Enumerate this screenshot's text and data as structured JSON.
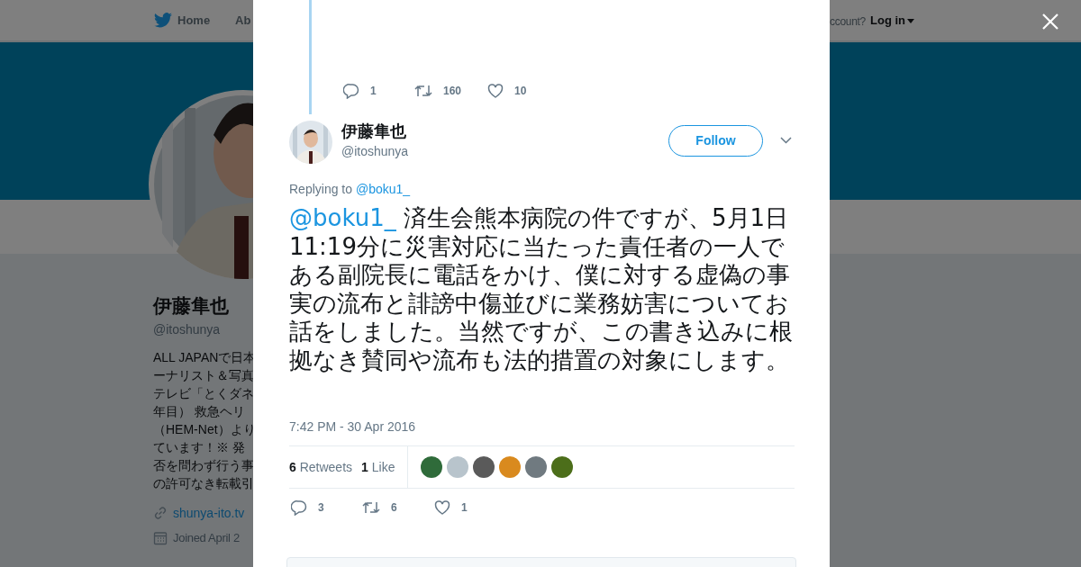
{
  "background_page": {
    "nav": {
      "home": "Home",
      "about": "Ab",
      "account_prompt": "ccount?",
      "login": "Log in"
    },
    "profile": {
      "name": "伊藤隼也",
      "handle": "@itoshunya",
      "bio_lines": [
        "ALL JAPANで日本",
        "ーナリスト＆写真",
        "テレビ「とくダネ",
        "年目） 救急ヘリ",
        "（HEM-Net）より",
        "ています！※ 発",
        "否を問わず行う事",
        "の許可なき転載引"
      ],
      "link": "shunya-ito.tv",
      "joined": "Joined April 2"
    }
  },
  "modal": {
    "previous_tweet": {
      "actions": [
        {
          "kind": "reply",
          "count": "1"
        },
        {
          "kind": "retweet",
          "count": "160"
        },
        {
          "kind": "like",
          "count": "10"
        }
      ]
    },
    "tweet": {
      "name": "伊藤隼也",
      "handle": "@itoshunya",
      "follow_button": "Follow",
      "replying_label": "Replying to",
      "replying_to": "@boku1_",
      "mention": "@boku1_",
      "text": "済生会熊本病院の件ですが、5月1日11:19分に災害対応に当たった責任者の一人である副院長に電話をかけ、僕に対する虚偽の事実の流布と誹謗中傷並びに業務妨害についてお話をしました。当然ですが、この書き込みに根拠なき賛同や流布も法的措置の対象にします。",
      "timestamp": "7:42 PM - 30 Apr 2016",
      "stats": [
        {
          "count": "6",
          "label": "Retweets"
        },
        {
          "count": "1",
          "label": "Like"
        }
      ],
      "likers": [
        {
          "color": "#2f6b3a"
        },
        {
          "color": "#b8c4cc"
        },
        {
          "color": "#5a5a5a"
        },
        {
          "color": "#d98a1e"
        },
        {
          "color": "#707a80"
        },
        {
          "color": "#4c6e1a"
        }
      ],
      "actions": [
        {
          "kind": "reply",
          "count": "3"
        },
        {
          "kind": "retweet",
          "count": "6"
        },
        {
          "kind": "like",
          "count": "1"
        }
      ]
    }
  }
}
